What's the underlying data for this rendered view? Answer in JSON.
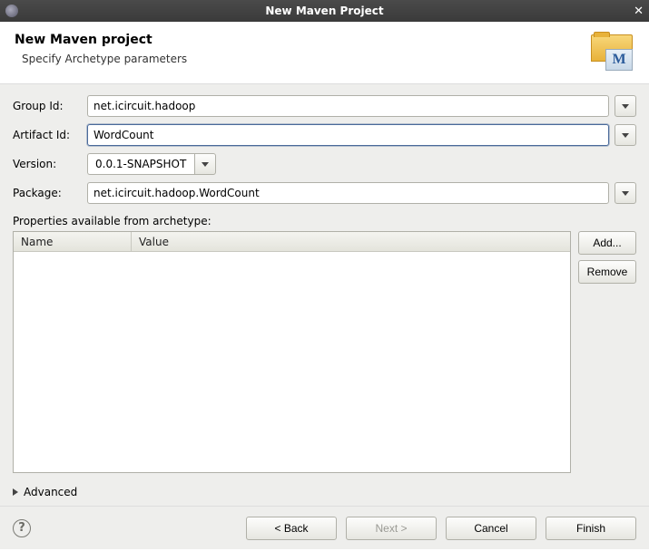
{
  "window": {
    "title": "New Maven Project"
  },
  "header": {
    "title": "New Maven project",
    "subtitle": "Specify Archetype parameters"
  },
  "form": {
    "group_id": {
      "label": "Group Id:",
      "value": "net.icircuit.hadoop"
    },
    "artifact_id": {
      "label": "Artifact Id:",
      "value": "WordCount"
    },
    "version": {
      "label": "Version:",
      "value": "0.0.1-SNAPSHOT"
    },
    "package": {
      "label": "Package:",
      "value": "net.icircuit.hadoop.WordCount"
    }
  },
  "properties": {
    "section_label": "Properties available from archetype:",
    "columns": {
      "name": "Name",
      "value": "Value"
    },
    "buttons": {
      "add": "Add...",
      "remove": "Remove"
    }
  },
  "advanced": {
    "label": "Advanced"
  },
  "footer": {
    "back": "< Back",
    "next": "Next >",
    "cancel": "Cancel",
    "finish": "Finish"
  }
}
